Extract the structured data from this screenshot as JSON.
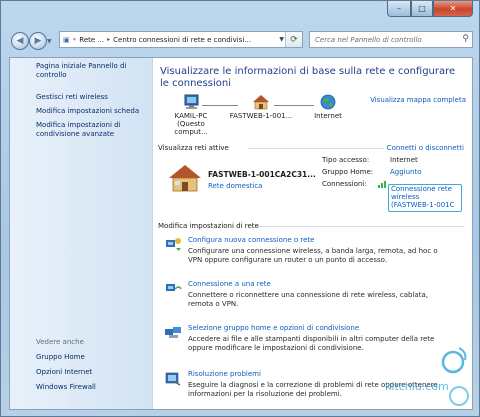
{
  "toolbar": {
    "window_buttons": {
      "minimize": "–",
      "maximize": "□",
      "close": "✕"
    }
  },
  "address": {
    "segments": [
      "Rete ...",
      "Centro connessioni di rete e condivisi..."
    ],
    "search_placeholder": "Cerca nel Pannello di controllo"
  },
  "sidebar": {
    "items": [
      {
        "label": "Pagina iniziale Pannello di controllo"
      },
      {
        "label": "Gestisci reti wireless"
      },
      {
        "label": "Modifica impostazioni scheda"
      },
      {
        "label": "Modifica impostazioni di condivisione avanzate"
      }
    ],
    "see_also_header": "Vedere anche",
    "see_also": [
      {
        "label": "Gruppo Home"
      },
      {
        "label": "Opzioni Internet"
      },
      {
        "label": "Windows Firewall"
      }
    ]
  },
  "main": {
    "title": "Visualizzare le informazioni di base sulla rete e configurare le connessioni",
    "map_link": "Visualizza mappa completa",
    "map_nodes": [
      {
        "label": "KAMIL-PC",
        "sub": "(Questo comput...",
        "icon": "computer-icon"
      },
      {
        "label": "FASTWEB-1-001...",
        "sub": "",
        "icon": "house-icon"
      },
      {
        "label": "Internet",
        "sub": "",
        "icon": "globe-icon"
      }
    ],
    "active_header": "Visualizza reti attive",
    "connect_link": "Connetti o disconnetti",
    "network_name": "FASTWEB-1-001CA2C31...",
    "network_type": "Rete domestica",
    "access_label": "Tipo accesso:",
    "access_value": "Internet",
    "homegroup_label": "Gruppo Home:",
    "homegroup_value": "Aggiunto",
    "connections_label": "Connessioni:",
    "connection_line1": "Connessione rete",
    "connection_line2": "wireless",
    "connection_line3": "(FASTWEB-1-001C",
    "settings_header": "Modifica impostazioni di rete",
    "tasks": [
      {
        "title": "Configura nuova connessione o rete",
        "desc": "Configurare una connessione wireless, a banda larga, remota, ad hoc o VPN oppure configurare un router o un punto di accesso.",
        "icon": "new-connection-icon"
      },
      {
        "title": "Connessione a una rete",
        "desc": "Connettere o riconnettere una connessione di rete wireless, cablata, remota o VPN.",
        "icon": "connect-network-icon"
      },
      {
        "title": "Selezione gruppo home e opzioni di condivisione",
        "desc": "Accedere ai file e alle stampanti disponibili in altri computer della rete oppure modificare le impostazioni di condivisione.",
        "icon": "homegroup-icon"
      },
      {
        "title": "Risoluzione problemi",
        "desc": "Eseguire la diagnosi e la correzione di problemi di rete oppure ottenere informazioni per la risoluzione dei problemi.",
        "icon": "troubleshoot-icon"
      }
    ]
  },
  "watermark": "kitchlu.com"
}
